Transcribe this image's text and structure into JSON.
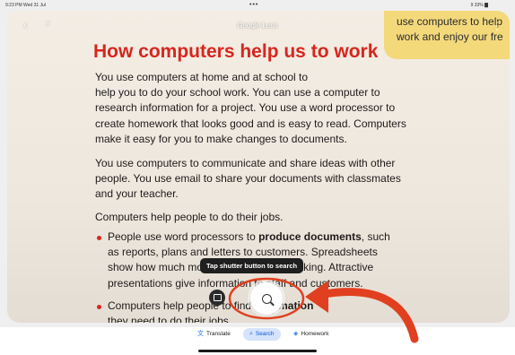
{
  "status_bar": {
    "time": "9:23 PM  Wed 31 Jul",
    "battery": "9 33% ▇"
  },
  "header": {
    "title": "Google Lens",
    "back_icon": "chevron-left-icon",
    "flash_icon": "flash-off-icon",
    "more_icon": "more-vert-icon"
  },
  "page": {
    "heading": "How computers help us to work",
    "paragraph1": "You use computers at home and at school to\nhelp you to do your school work. You can use a computer to\nresearch information for a project. You use a word processor to\ncreate homework that looks good and is easy to read. Computers\nmake it easy for you to make changes to documents.",
    "paragraph2": "You use computers to communicate and share ideas with other\npeople. You use email to share your documents with classmates\nand your teacher.",
    "paragraph3": "Computers help people to do their jobs.",
    "bullet1_start": "People use word processors to ",
    "bullet1_bold": "produce documents",
    "bullet1_rest": ", such\nas reports, plans and letters to customers. Spreadsheets\nshow how much money a business is making. Attractive\npresentations give information to staff and customers.",
    "bullet2_start": "Computers help people to find ",
    "bullet2_bold": "information",
    "bullet2_rest": " they need to do their jobs."
  },
  "ribbon": {
    "text": "use computers to help\nwork and enjoy our fre"
  },
  "tooltip": {
    "text": "Tap shutter button to search"
  },
  "tabs": [
    {
      "label": "Translate",
      "icon": "translate-icon"
    },
    {
      "label": "Search",
      "icon": "search-icon"
    },
    {
      "label": "Homework",
      "icon": "homework-icon"
    }
  ],
  "colors": {
    "heading_red": "#d7261e",
    "accent_blue": "#0b57d0",
    "annotation_red": "#e0401f"
  }
}
